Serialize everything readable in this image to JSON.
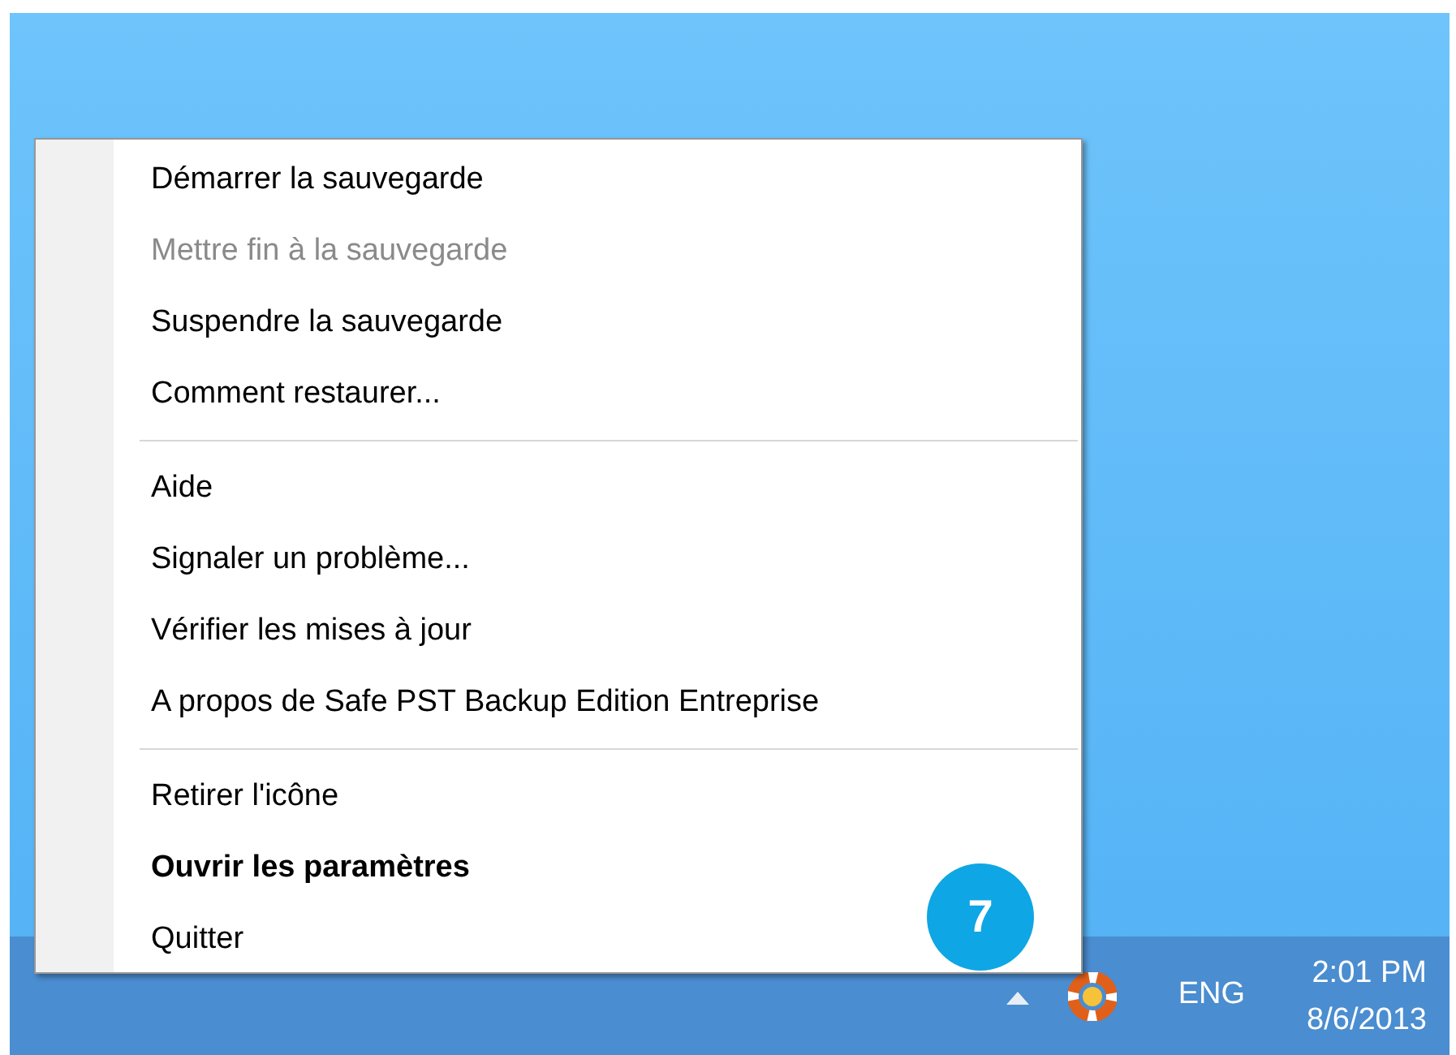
{
  "menu": {
    "items": [
      {
        "kind": "item",
        "label": "Démarrer la sauvegarde",
        "disabled": false,
        "default": false
      },
      {
        "kind": "item",
        "label": "Mettre fin à la sauvegarde",
        "disabled": true,
        "default": false
      },
      {
        "kind": "item",
        "label": "Suspendre la sauvegarde",
        "disabled": false,
        "default": false
      },
      {
        "kind": "item",
        "label": "Comment restaurer...",
        "disabled": false,
        "default": false
      },
      {
        "kind": "separator"
      },
      {
        "kind": "item",
        "label": "Aide",
        "disabled": false,
        "default": false
      },
      {
        "kind": "item",
        "label": "Signaler un problème...",
        "disabled": false,
        "default": false
      },
      {
        "kind": "item",
        "label": "Vérifier les mises à jour",
        "disabled": false,
        "default": false
      },
      {
        "kind": "item",
        "label": "A propos de Safe PST Backup Edition Entreprise",
        "disabled": false,
        "default": false
      },
      {
        "kind": "separator"
      },
      {
        "kind": "item",
        "label": "Retirer l'icône",
        "disabled": false,
        "default": false
      },
      {
        "kind": "item",
        "label": "Ouvrir les paramètres",
        "disabled": false,
        "default": true
      },
      {
        "kind": "item",
        "label": "Quitter",
        "disabled": false,
        "default": false
      }
    ]
  },
  "callout": {
    "label": "7"
  },
  "taskbar": {
    "language": "ENG",
    "time": "2:01 PM",
    "date": "8/6/2013"
  }
}
